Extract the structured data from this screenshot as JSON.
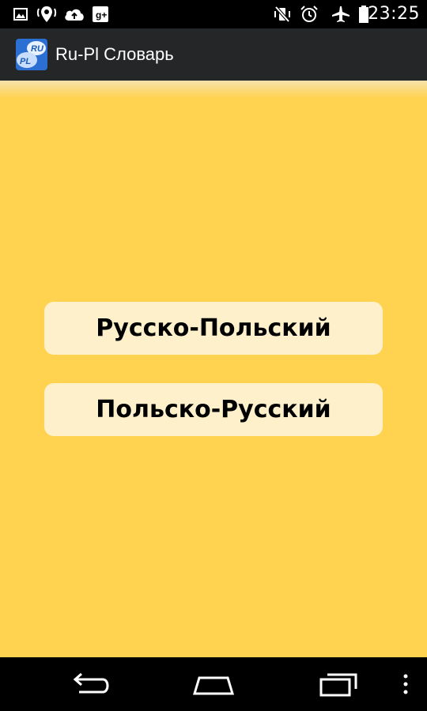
{
  "status_bar": {
    "time": "23:25",
    "left_icons": [
      "gallery-icon",
      "location-icon",
      "cloud-upload-icon",
      "google-plus-icon"
    ],
    "right_icons": [
      "vibrate-off-icon",
      "alarm-icon",
      "airplane-mode-icon",
      "battery-icon"
    ]
  },
  "action_bar": {
    "icon_text_top": "RU",
    "icon_text_bottom": "PL",
    "title": "Ru-Pl Словарь"
  },
  "main": {
    "buttons": [
      {
        "label": "Русско-Польский"
      },
      {
        "label": "Польско-Русский"
      }
    ],
    "background_color": "#FFD24F",
    "button_color": "#FDF0CB"
  },
  "nav_bar": {
    "icons": [
      "back-icon",
      "home-icon",
      "recent-apps-icon",
      "menu-icon"
    ]
  }
}
